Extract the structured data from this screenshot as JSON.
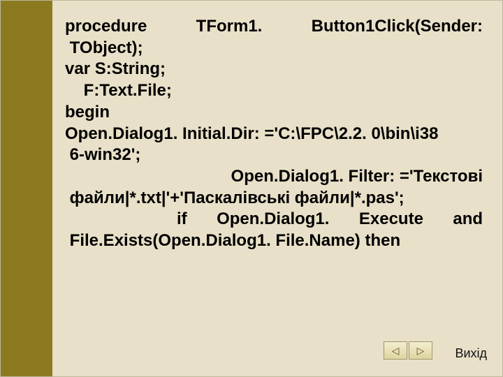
{
  "code": {
    "l1a": "procedure",
    "l1b": "TForm1. Button1Click(Sender:",
    "l2": " TObject);",
    "l3": "var S:String;",
    "l4": "    F:Text.File;",
    "l5": "begin",
    "l6": "Open.Dialog1. Initial.Dir: ='C:\\FPC\\2.2. 0\\bin\\i38",
    "l7": " 6-win32';",
    "l8": "Open.Dialog1. Filter: ='Текстові",
    "l9": " файли|*.txt|'+'Паскалівські файли|*.pas';",
    "l10a": "if",
    "l10b": "Open.Dialog1. Execute",
    "l10c": "and",
    "l11": " File.Exists(Open.Dialog1. File.Name) then"
  },
  "nav": {
    "prev": "◁",
    "next": "▷"
  },
  "exit_label": "Вихід"
}
